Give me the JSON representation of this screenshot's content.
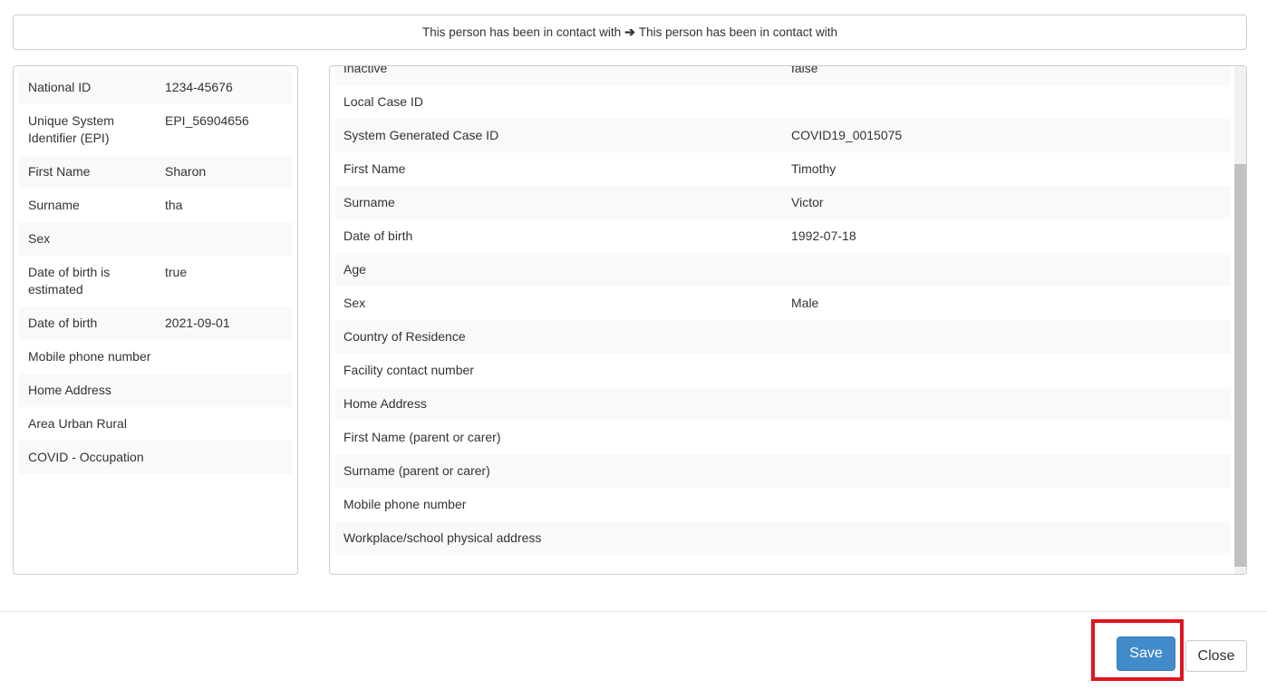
{
  "header": {
    "text_left": "This person has been in contact with",
    "arrow": "➔",
    "text_right": "This person has been in contact with"
  },
  "left_panel": {
    "rows": [
      {
        "label": "National ID",
        "value": "1234-45676"
      },
      {
        "label": "Unique System Identifier (EPI)",
        "value": "EPI_56904656"
      },
      {
        "label": "First Name",
        "value": "Sharon"
      },
      {
        "label": "Surname",
        "value": "tha"
      },
      {
        "label": "Sex",
        "value": ""
      },
      {
        "label": "Date of birth is estimated",
        "value": "true"
      },
      {
        "label": "Date of birth",
        "value": "2021-09-01"
      },
      {
        "label": "Mobile phone number",
        "value": ""
      },
      {
        "label": "Home Address",
        "value": ""
      },
      {
        "label": "Area Urban Rural",
        "value": ""
      },
      {
        "label": "COVID - Occupation",
        "value": ""
      }
    ]
  },
  "right_panel": {
    "rows": [
      {
        "label": "Inactive",
        "value": "false"
      },
      {
        "label": "Local Case ID",
        "value": ""
      },
      {
        "label": "System Generated Case ID",
        "value": "COVID19_0015075"
      },
      {
        "label": "First Name",
        "value": "Timothy"
      },
      {
        "label": "Surname",
        "value": "Victor"
      },
      {
        "label": "Date of birth",
        "value": "1992-07-18"
      },
      {
        "label": "Age",
        "value": ""
      },
      {
        "label": "Sex",
        "value": "Male"
      },
      {
        "label": "Country of Residence",
        "value": ""
      },
      {
        "label": "Facility contact number",
        "value": ""
      },
      {
        "label": "Home Address",
        "value": ""
      },
      {
        "label": "First Name (parent or carer)",
        "value": ""
      },
      {
        "label": "Surname (parent or carer)",
        "value": ""
      },
      {
        "label": "Mobile phone number",
        "value": ""
      },
      {
        "label": "Workplace/school physical address",
        "value": ""
      }
    ]
  },
  "footer": {
    "save_label": "Save",
    "close_label": "Close"
  },
  "colors": {
    "primary": "#428bca",
    "highlight": "#e0141e",
    "stripe": "#f9f9f9"
  }
}
